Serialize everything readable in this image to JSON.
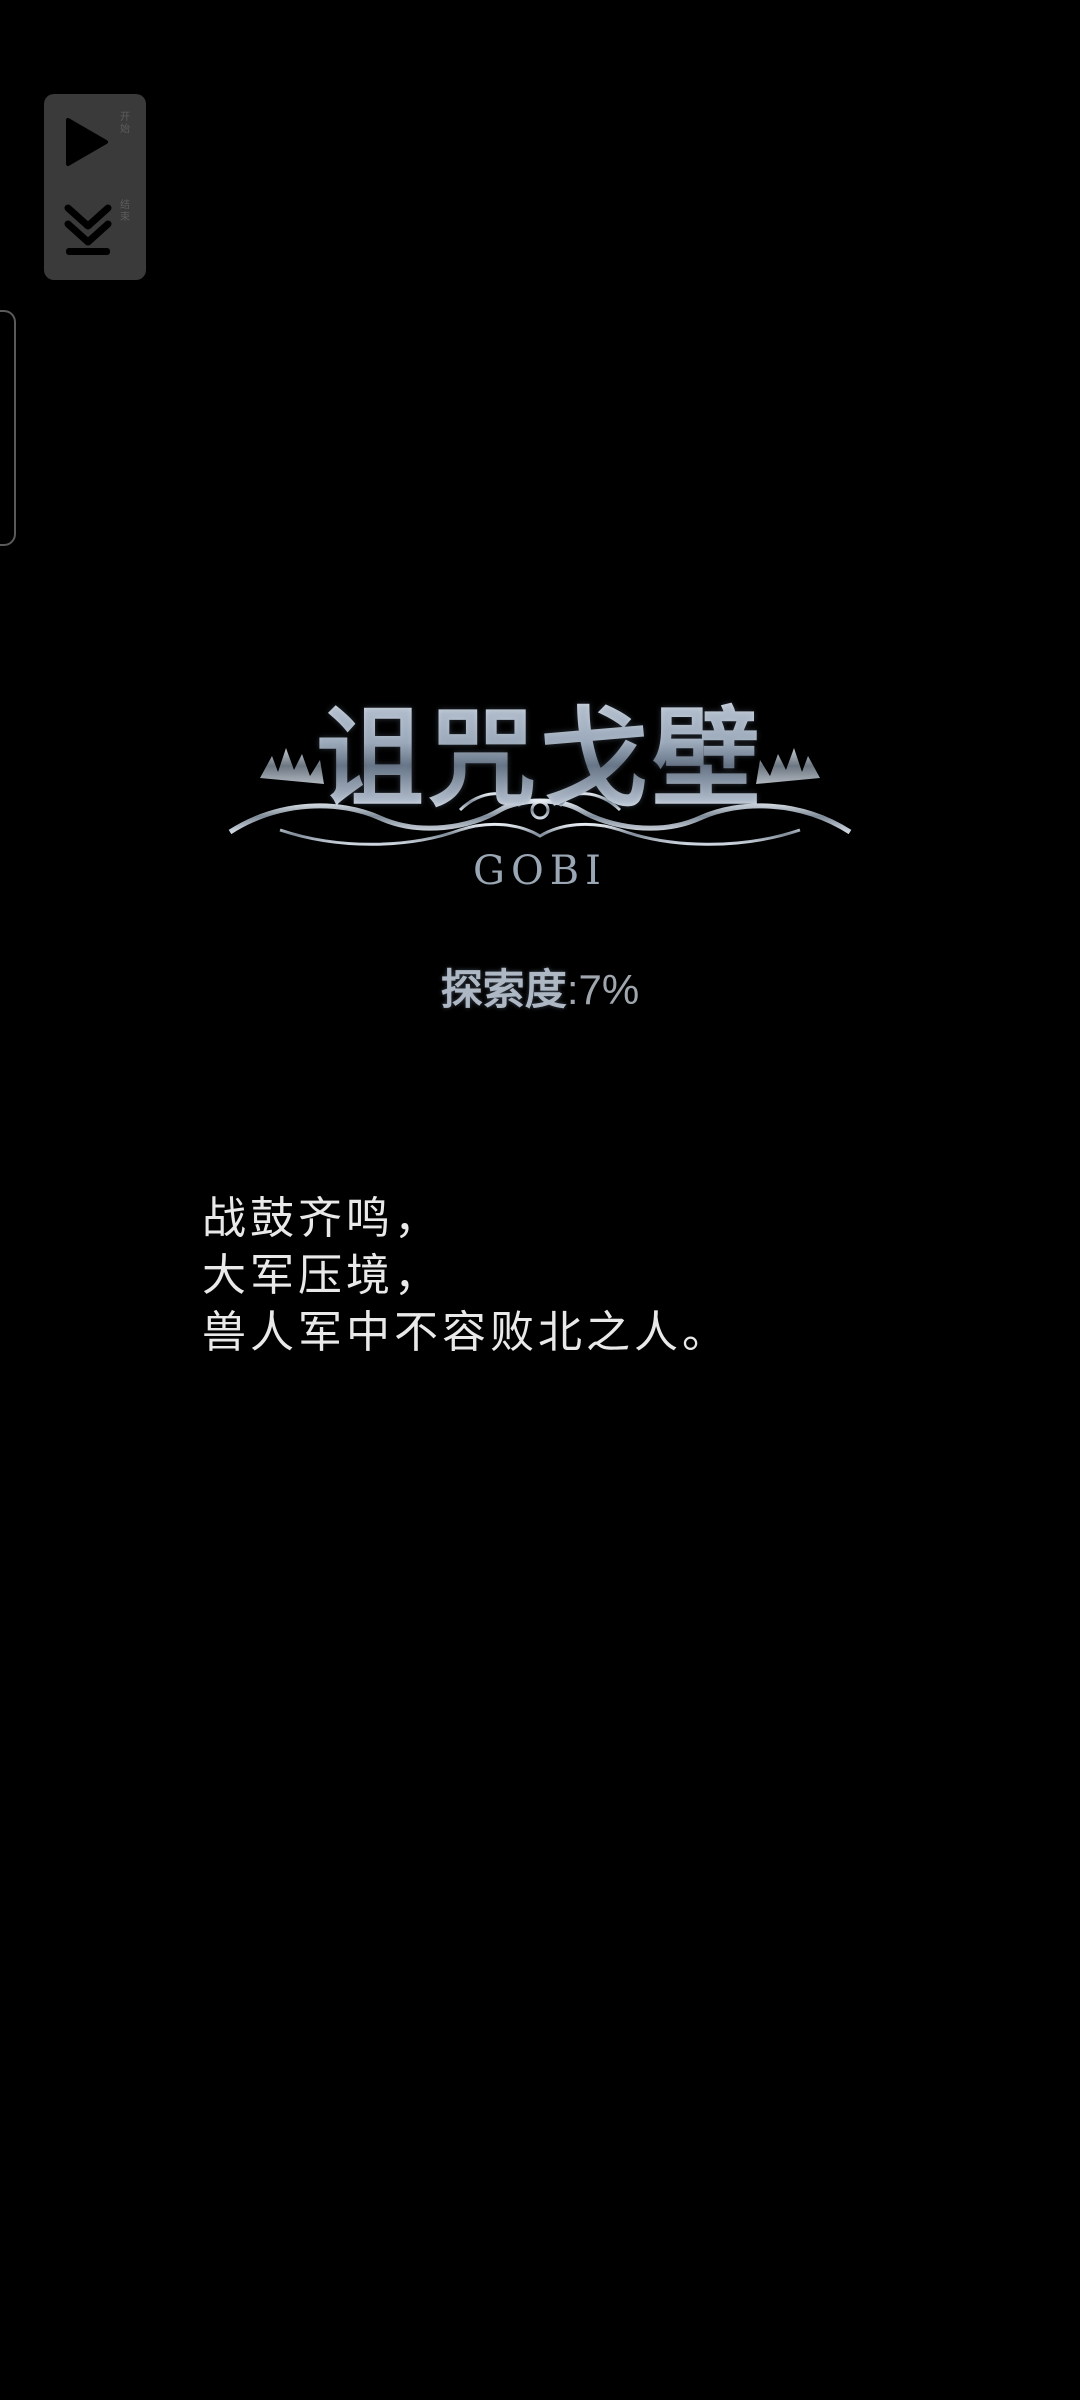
{
  "float_panel": {
    "start_label": "开始",
    "stop_label": "结束"
  },
  "logo": {
    "title": "诅咒戈壁",
    "subtitle": "GOBI"
  },
  "exploration": {
    "label": "探索度",
    "separator": ":",
    "value": "7%"
  },
  "story": {
    "lines": [
      "战鼓齐鸣，",
      "大军压境，",
      "兽人军中不容败北之人。"
    ]
  },
  "colors": {
    "background": "#000000",
    "panel": "#3a3a3a",
    "text": "#e9e9e9",
    "metal": "#c9d2dc"
  }
}
